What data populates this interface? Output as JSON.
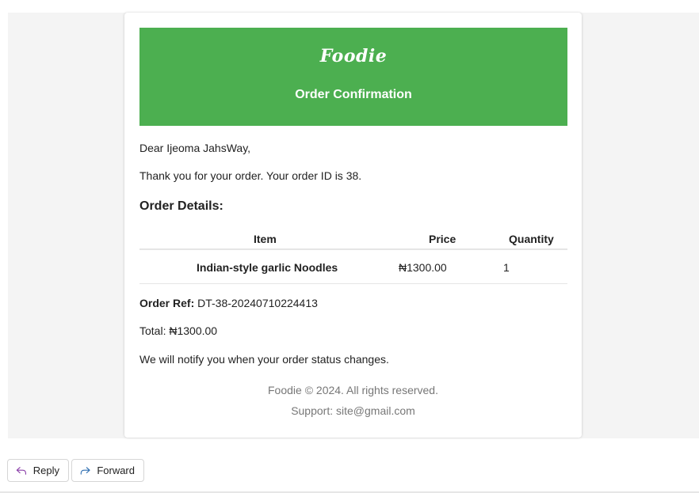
{
  "email": {
    "brand": "Foodie",
    "header_title": "Order Confirmation",
    "greeting": "Dear Ijeoma JahsWay,",
    "thanks": "Thank you for your order. Your order ID is 38.",
    "details_title": "Order Details:",
    "table": {
      "headers": {
        "item": "Item",
        "price": "Price",
        "quantity": "Quantity"
      },
      "rows": [
        {
          "item": "Indian-style garlic Noodles",
          "price": "₦1300.00",
          "quantity": "1"
        }
      ]
    },
    "order_ref_label": "Order Ref:",
    "order_ref_value": "DT-38-20240710224413",
    "total": "Total: ₦1300.00",
    "notify": "We will notify you when your order status changes.",
    "footer_copyright": "Foodie © 2024. All rights reserved.",
    "footer_support": "Support: site@gmail.com",
    "colors": {
      "header_bg": "#4caf50",
      "header_text": "#ffffff",
      "footer_text": "#777777"
    }
  },
  "actions": {
    "reply_label": "Reply",
    "forward_label": "Forward",
    "reply_icon": "reply-arrow-icon",
    "forward_icon": "forward-arrow-icon"
  }
}
